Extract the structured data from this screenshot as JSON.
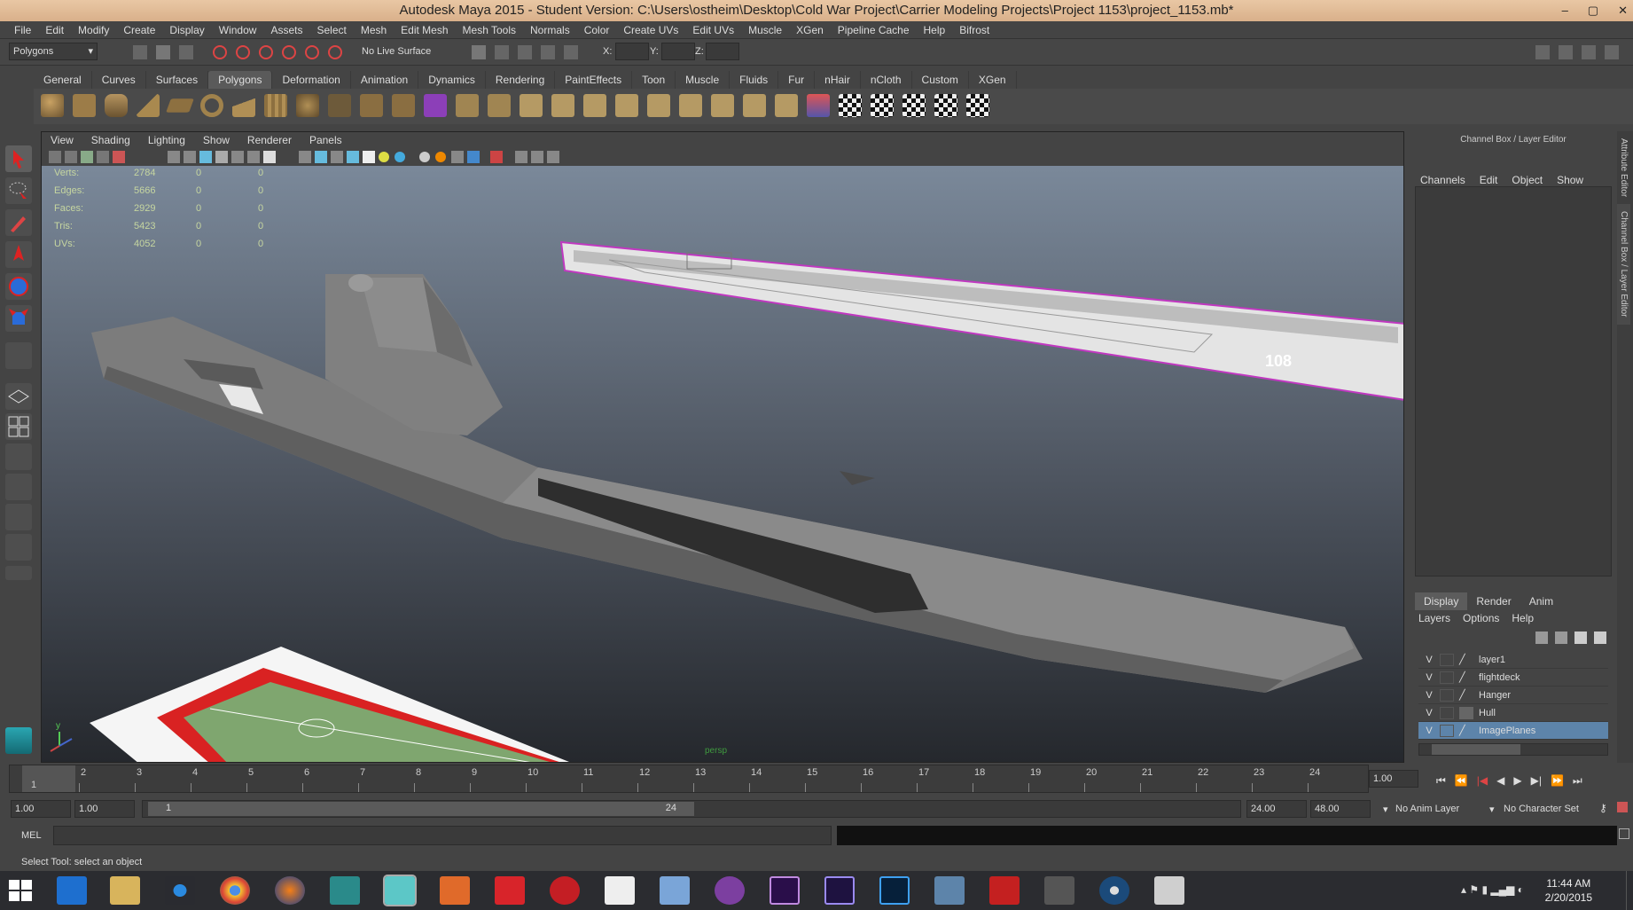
{
  "window": {
    "title": "Autodesk Maya 2015 - Student Version: C:\\Users\\ostheim\\Desktop\\Cold War Project\\Carrier Modeling Projects\\Project 1153\\project_1153.mb*",
    "controls": [
      "–",
      "▢",
      "✕"
    ]
  },
  "menubar": [
    "File",
    "Edit",
    "Modify",
    "Create",
    "Display",
    "Window",
    "Assets",
    "Select",
    "Mesh",
    "Edit Mesh",
    "Mesh Tools",
    "Normals",
    "Color",
    "Create UVs",
    "Edit UVs",
    "Muscle",
    "XGen",
    "Pipeline Cache",
    "Help",
    "Bifrost"
  ],
  "statusline": {
    "mode": "Polygons",
    "live_surface": "No Live Surface",
    "coord_labels": [
      "X:",
      "Y:",
      "Z:"
    ]
  },
  "shelf_tabs": [
    "General",
    "Curves",
    "Surfaces",
    "Polygons",
    "Deformation",
    "Animation",
    "Dynamics",
    "Rendering",
    "PaintEffects",
    "Toon",
    "Muscle",
    "Fluids",
    "Fur",
    "nHair",
    "nCloth",
    "Custom",
    "XGen"
  ],
  "shelf_active": "Polygons",
  "viewport": {
    "menu": [
      "View",
      "Shading",
      "Lighting",
      "Show",
      "Renderer",
      "Panels"
    ],
    "hud": [
      {
        "label": "Verts:",
        "v1": "2784",
        "v2": "0",
        "v3": "0"
      },
      {
        "label": "Edges:",
        "v1": "5666",
        "v2": "0",
        "v3": "0"
      },
      {
        "label": "Faces:",
        "v1": "2929",
        "v2": "0",
        "v3": "0"
      },
      {
        "label": "Tris:",
        "v1": "5423",
        "v2": "0",
        "v3": "0"
      },
      {
        "label": "UVs:",
        "v1": "4052",
        "v2": "0",
        "v3": "0"
      }
    ],
    "camera": "persp",
    "hull_number": "108",
    "axis_label": "y"
  },
  "channel_box": {
    "title": "Channel Box / Layer Editor",
    "menu": [
      "Channels",
      "Edit",
      "Object",
      "Show"
    ],
    "layer_tabs": [
      "Display",
      "Render",
      "Anim"
    ],
    "layer_menu": [
      "Layers",
      "Options",
      "Help"
    ],
    "layers": [
      {
        "vis": "V",
        "name": "layer1"
      },
      {
        "vis": "V",
        "name": "flightdeck"
      },
      {
        "vis": "V",
        "name": "Hanger"
      },
      {
        "vis": "V",
        "name": "Hull"
      },
      {
        "vis": "V",
        "name": "ImagePlanes"
      }
    ],
    "side_tabs": [
      "Attribute Editor",
      "Channel Box / Layer Editor"
    ]
  },
  "timeline": {
    "frames": [
      "1",
      "2",
      "3",
      "4",
      "5",
      "6",
      "7",
      "8",
      "9",
      "10",
      "11",
      "12",
      "13",
      "14",
      "15",
      "16",
      "17",
      "18",
      "19",
      "20",
      "21",
      "22",
      "23",
      "24"
    ],
    "current_frame": "1",
    "current_time_field": "1.00"
  },
  "range": {
    "start": "1.00",
    "playback_start": "1.00",
    "range_start": "1",
    "range_end": "24",
    "playback_end": "24.00",
    "end": "48.00",
    "anim_layer": "No Anim Layer",
    "char_set": "No Character Set"
  },
  "commandline": {
    "label": "MEL"
  },
  "helpline": "Select Tool: select an object",
  "taskbar": {
    "time": "11:44 AM",
    "date": "2/20/2015"
  },
  "colors": {
    "accent": "#5d84aa",
    "titlebar": "#e0bb95",
    "viewport_top": "#7f8ea0",
    "viewport_bottom": "#25282d"
  }
}
